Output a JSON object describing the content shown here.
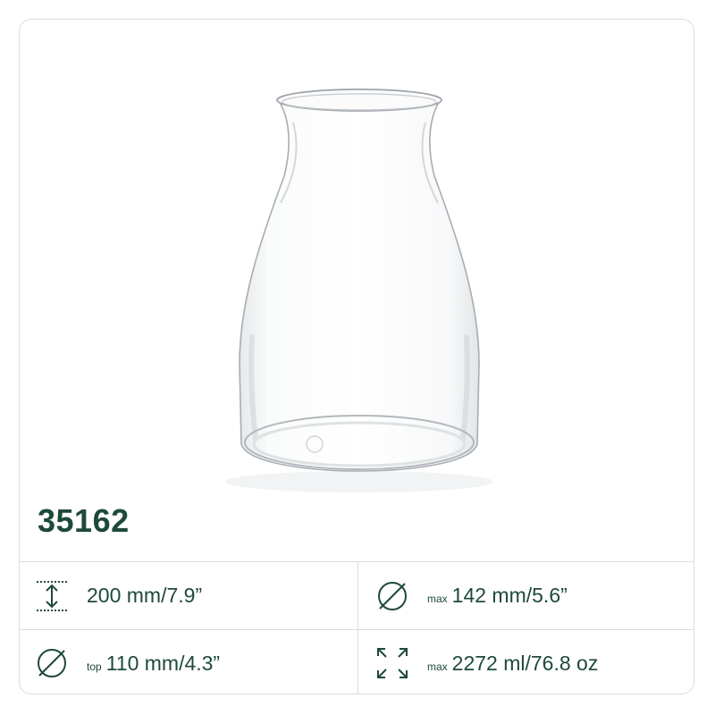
{
  "product": {
    "code": "35162",
    "image_alt": "clear glass vase"
  },
  "colors": {
    "brand_green": "#1e4a38",
    "border": "#dcdcdc",
    "background": "#ffffff"
  },
  "specs": [
    {
      "icon": "height-icon",
      "qualifier": "",
      "value": "200 mm/7.9”"
    },
    {
      "icon": "diameter-icon",
      "qualifier": "max",
      "value": "142 mm/5.6”"
    },
    {
      "icon": "diameter-icon",
      "qualifier": "top",
      "value": "110 mm/4.3”"
    },
    {
      "icon": "capacity-icon",
      "qualifier": "max",
      "value": "2272 ml/76.8 oz"
    }
  ]
}
